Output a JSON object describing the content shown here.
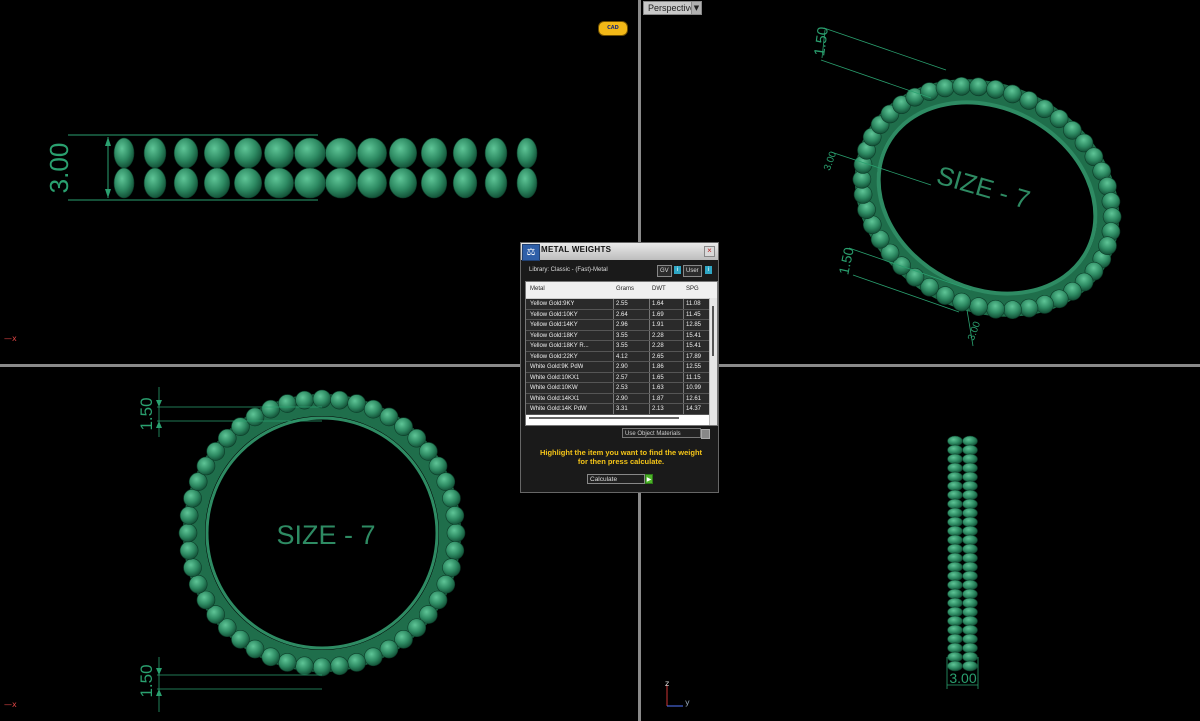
{
  "viewport": {
    "perspective_label": "Perspective",
    "perspective_arrow": "▼",
    "logo_text": "CAD"
  },
  "annotations": {
    "front_height": "3.00",
    "persp_top": "1.50",
    "persp_mid": "3.00",
    "persp_left": "1.50",
    "persp_bottom": "3.00",
    "persp_size": "SIZE - 7",
    "top_dim": "1.50",
    "top_size": "SIZE - 7",
    "bottom_dim": "1.50",
    "side_width": "3.00"
  },
  "axes": {
    "x_mark": "x",
    "z_label": "z",
    "y_label": "y"
  },
  "dialog": {
    "title": "METAL WEIGHTS",
    "close": "×",
    "library": "Library: Classic - (Fast)-Metal",
    "btn_gv": "GV",
    "btn_user": "User",
    "indicator": "i",
    "columns": [
      "Metal",
      "Grams",
      "DWT",
      "SPG"
    ],
    "rows": [
      [
        "Yellow Gold:9KY",
        "2.55",
        "1.64",
        "11.08"
      ],
      [
        "Yellow Gold:10KY",
        "2.64",
        "1.69",
        "11.45"
      ],
      [
        "Yellow Gold:14KY",
        "2.96",
        "1.91",
        "12.85"
      ],
      [
        "Yellow Gold:18KY",
        "3.55",
        "2.28",
        "15.41"
      ],
      [
        "Yellow Gold:18KY R...",
        "3.55",
        "2.28",
        "15.41"
      ],
      [
        "Yellow Gold:22KY",
        "4.12",
        "2.65",
        "17.89"
      ],
      [
        "White Gold:9K PdW",
        "2.90",
        "1.86",
        "12.55"
      ],
      [
        "White Gold:10KX1",
        "2.57",
        "1.65",
        "11.15"
      ],
      [
        "White Gold:10KW",
        "2.53",
        "1.63",
        "10.99"
      ],
      [
        "White Gold:14KX1",
        "2.90",
        "1.87",
        "12.61"
      ],
      [
        "White Gold:14K PdW",
        "3.31",
        "2.13",
        "14.37"
      ]
    ],
    "use_object_materials": "Use Object Materials",
    "hint_line1": "Highlight the item you want to find the weight",
    "hint_line2": "for then press calculate.",
    "calculate": "Calculate",
    "calc_arrow": "▶"
  },
  "colors": {
    "ring": "#2e8b63",
    "ring_dark": "#14573b",
    "dim": "#2aa06f",
    "hint": "#f5c518"
  }
}
